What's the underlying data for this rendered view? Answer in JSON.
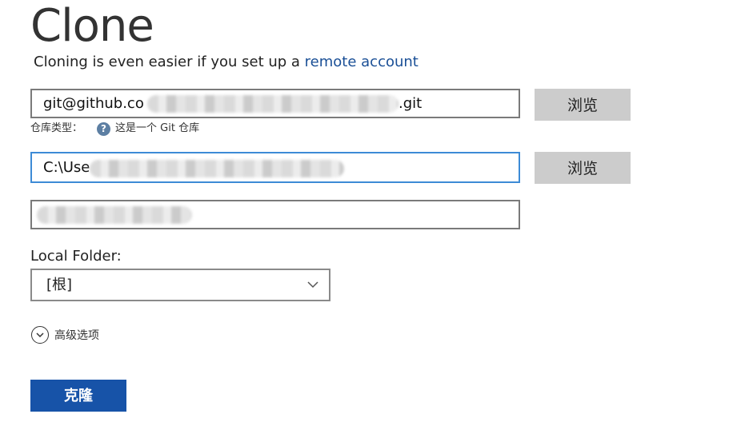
{
  "header": {
    "title": "Clone",
    "subtitle_prefix": "Cloning is even easier if you set up a",
    "subtitle_link": "remote account"
  },
  "repo_url": {
    "value_start": "git@github.co",
    "value_end": ".git",
    "browse_label": "浏览"
  },
  "repo_type": {
    "label": "仓库类型：",
    "help_icon": "?",
    "value": "这是一个 Git 仓库"
  },
  "local_path": {
    "value_start": "C:\\Use",
    "browse_label": "浏览"
  },
  "name_field": {
    "value": ""
  },
  "local_folder": {
    "label": "Local Folder:",
    "selected": "[根]"
  },
  "advanced": {
    "label": "高级选项"
  },
  "actions": {
    "clone_label": "克隆"
  },
  "colors": {
    "accent": "#1753a8",
    "link": "#1a4f96",
    "focus_border": "#3d8bd6"
  }
}
